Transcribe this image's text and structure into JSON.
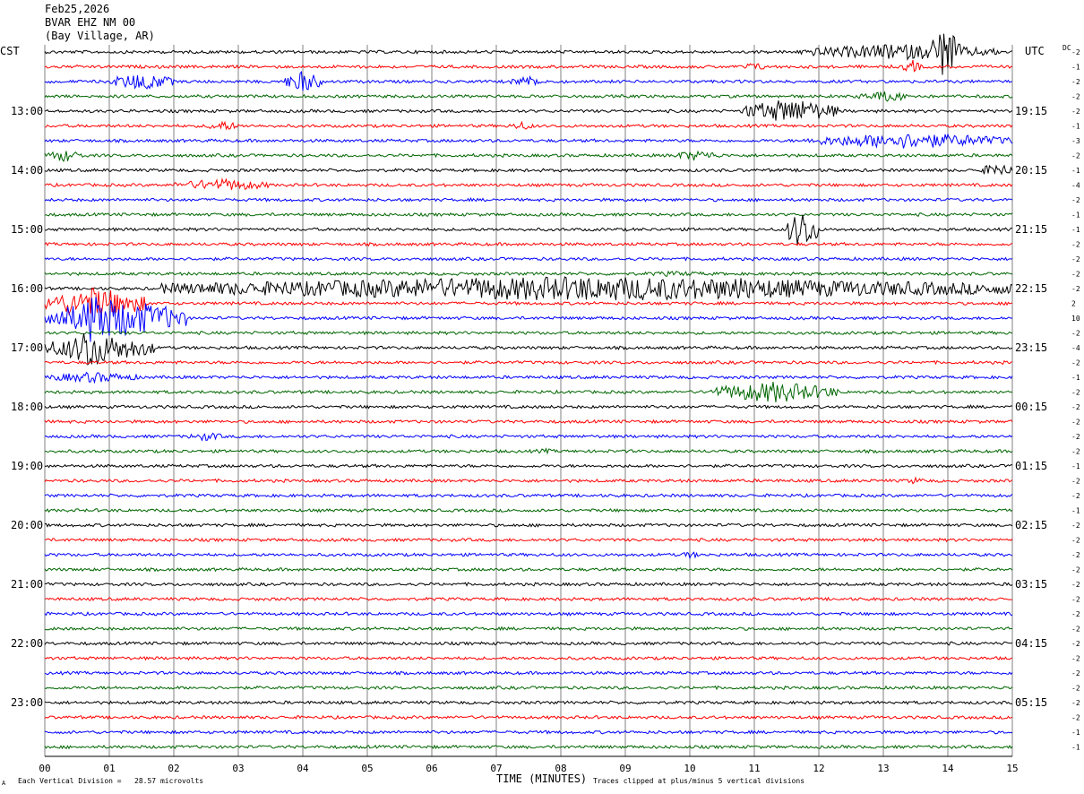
{
  "header": {
    "date": "Feb25,2026",
    "station": "BVAR EHZ NM 00",
    "location": "(Bay Village, AR)"
  },
  "left_axis_label": "CST",
  "right_axis_label": "UTC",
  "dc_label": "DC",
  "footer": {
    "xlabel": "TIME (MINUTES)",
    "vertical_division": "Each Vertical Division =   28.57 microvolts",
    "clip_note": "Traces clipped at plus/minus 5 vertical divisions",
    "corner_mark": "A"
  },
  "colors": {
    "trace_cycle": [
      "#000000",
      "#ff0000",
      "#0000ff",
      "#006600"
    ],
    "grid": "#808080"
  },
  "chart_data": {
    "type": "line",
    "title": "",
    "xlabel": "TIME (MINUTES)",
    "xlim": [
      0,
      15
    ],
    "x_ticks": [
      "00",
      "01",
      "02",
      "03",
      "04",
      "05",
      "06",
      "07",
      "08",
      "09",
      "10",
      "11",
      "12",
      "13",
      "14",
      "15"
    ],
    "left_time_labels": [
      "13:00",
      "14:00",
      "15:00",
      "16:00",
      "17:00",
      "18:00",
      "19:00",
      "20:00",
      "21:00",
      "22:00",
      "23:00"
    ],
    "right_time_labels": [
      "19:15",
      "20:15",
      "21:15",
      "22:15",
      "23:15",
      "00:15",
      "01:15",
      "02:15",
      "03:15",
      "04:15",
      "05:15"
    ],
    "trace_count": 48,
    "first_labeled_trace": 4,
    "traces_per_hour": 4,
    "dc_offsets": [
      "-2",
      "-1",
      "-2",
      "-2",
      "-2",
      "-1",
      "-3",
      "-2",
      "-1",
      "-4",
      "-2",
      "-1",
      "-1",
      "-2",
      "-2",
      "-2",
      "-2",
      "2",
      "10",
      "-2",
      "-4",
      "-2",
      "-1",
      "-2",
      "-2",
      "-2",
      "-2",
      "-2",
      "-1",
      "-2",
      "-2",
      "-1",
      "-2",
      "-2",
      "-2",
      "-2",
      "-2",
      "-2",
      "-2",
      "-2",
      "-2",
      "-2",
      "-2",
      "-2",
      "-2",
      "-2",
      "-1",
      "-1"
    ],
    "events": [
      {
        "trace": 0,
        "start_min": 11.7,
        "end_min": 14.8,
        "amplitude": 9
      },
      {
        "trace": 0,
        "start_min": 13.7,
        "end_min": 14.2,
        "amplitude": 30
      },
      {
        "trace": 1,
        "start_min": 10.8,
        "end_min": 11.2,
        "amplitude": 5
      },
      {
        "trace": 1,
        "start_min": 13.3,
        "end_min": 13.6,
        "amplitude": 8
      },
      {
        "trace": 2,
        "start_min": 1.0,
        "end_min": 2.0,
        "amplitude": 10
      },
      {
        "trace": 2,
        "start_min": 3.7,
        "end_min": 4.3,
        "amplitude": 12
      },
      {
        "trace": 2,
        "start_min": 7.2,
        "end_min": 7.8,
        "amplitude": 6
      },
      {
        "trace": 3,
        "start_min": 12.6,
        "end_min": 13.5,
        "amplitude": 6
      },
      {
        "trace": 4,
        "start_min": 10.8,
        "end_min": 12.3,
        "amplitude": 14
      },
      {
        "trace": 5,
        "start_min": 2.5,
        "end_min": 3.0,
        "amplitude": 6
      },
      {
        "trace": 5,
        "start_min": 7.2,
        "end_min": 7.6,
        "amplitude": 5
      },
      {
        "trace": 6,
        "start_min": 11.8,
        "end_min": 15.0,
        "amplitude": 9
      },
      {
        "trace": 7,
        "start_min": 0.0,
        "end_min": 0.6,
        "amplitude": 7
      },
      {
        "trace": 7,
        "start_min": 9.7,
        "end_min": 10.5,
        "amplitude": 6
      },
      {
        "trace": 8,
        "start_min": 14.5,
        "end_min": 15.0,
        "amplitude": 8
      },
      {
        "trace": 9,
        "start_min": 2.0,
        "end_min": 3.5,
        "amplitude": 7
      },
      {
        "trace": 12,
        "start_min": 11.5,
        "end_min": 12.0,
        "amplitude": 22
      },
      {
        "trace": 15,
        "start_min": 9.0,
        "end_min": 10.5,
        "amplitude": 3
      },
      {
        "trace": 16,
        "start_min": 1.8,
        "end_min": 15.0,
        "amplitude": 14
      },
      {
        "trace": 16,
        "start_min": 10.7,
        "end_min": 10.8,
        "amplitude": 30
      },
      {
        "trace": 17,
        "start_min": 0.0,
        "end_min": 1.6,
        "amplitude": 18
      },
      {
        "trace": 18,
        "start_min": 0.0,
        "end_min": 2.2,
        "amplitude": 22
      },
      {
        "trace": 18,
        "start_min": 0.6,
        "end_min": 1.0,
        "amplitude": 40
      },
      {
        "trace": 20,
        "start_min": 0.0,
        "end_min": 1.7,
        "amplitude": 16
      },
      {
        "trace": 20,
        "start_min": 0.5,
        "end_min": 0.9,
        "amplitude": 30
      },
      {
        "trace": 22,
        "start_min": 0.0,
        "end_min": 1.5,
        "amplitude": 6
      },
      {
        "trace": 23,
        "start_min": 10.3,
        "end_min": 12.3,
        "amplitude": 12
      },
      {
        "trace": 26,
        "start_min": 2.2,
        "end_min": 2.8,
        "amplitude": 5
      },
      {
        "trace": 27,
        "start_min": 7.5,
        "end_min": 8.0,
        "amplitude": 3
      },
      {
        "trace": 29,
        "start_min": 13.3,
        "end_min": 13.7,
        "amplitude": 4
      },
      {
        "trace": 34,
        "start_min": 9.8,
        "end_min": 10.2,
        "amplitude": 4
      }
    ]
  }
}
